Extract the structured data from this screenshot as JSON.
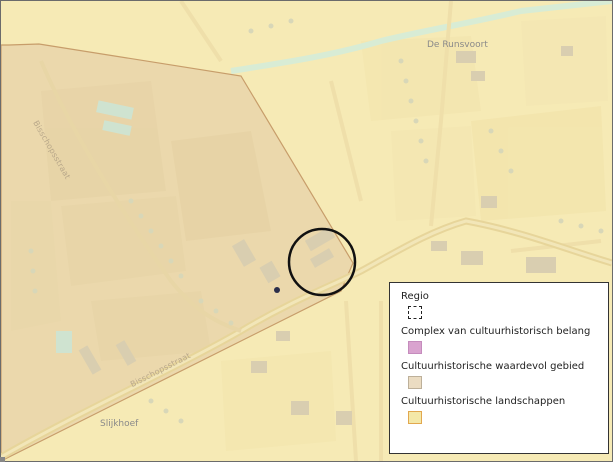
{
  "map": {
    "place_labels": [
      {
        "id": "runsvoort",
        "text": "De Runsvoort"
      },
      {
        "id": "slijkhoef",
        "text": "Slijkhoef"
      }
    ],
    "street_labels": [
      {
        "id": "street-north",
        "text": "Bisschopsstraat"
      },
      {
        "id": "street-south",
        "text": "Bisschopsstraat"
      }
    ],
    "colors": {
      "background_landscape": "#f6eab5",
      "valuable_area_fill": "#ebd8ac",
      "valuable_area_border": "#c79d6a",
      "road": "#eadcaa",
      "water": "#d6ecd6",
      "marker_circle": "#111111",
      "point_marker": "#2b2e4a"
    }
  },
  "legend": {
    "title": "Regio",
    "items": [
      {
        "label": "Complex van cultuurhistorisch belang",
        "swatch_color": "#d9a3cf",
        "style": "solid"
      },
      {
        "label": "Cultuurhistorische waardevol gebied",
        "swatch_color": "#ebdcc2",
        "style": "solid"
      },
      {
        "label": "Cultuurhistorische landschappen",
        "swatch_color": "#f4e8a8",
        "border_color": "#e2a84f",
        "style": "outline"
      }
    ]
  }
}
